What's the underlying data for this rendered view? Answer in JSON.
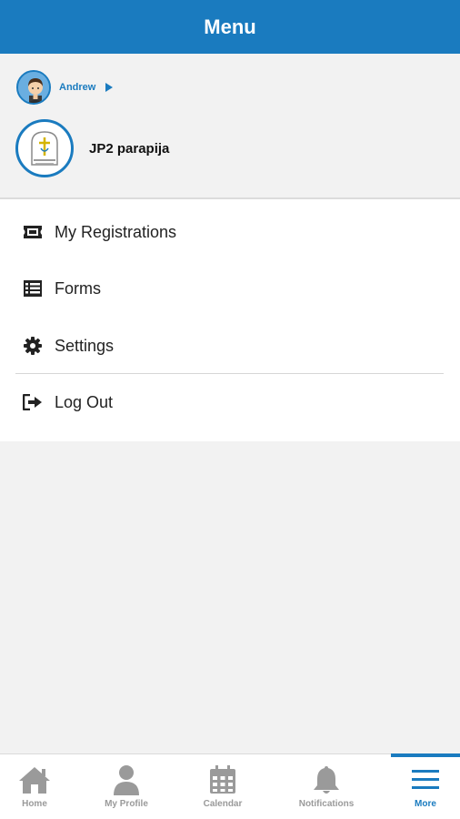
{
  "header": {
    "title": "Menu"
  },
  "user": {
    "name": "Andrew"
  },
  "organization": {
    "name": "JP2 parapija"
  },
  "menu": {
    "items": [
      {
        "label": "My Registrations",
        "icon": "ticket-icon"
      },
      {
        "label": "Forms",
        "icon": "list-icon"
      },
      {
        "label": "Settings",
        "icon": "gear-icon"
      },
      {
        "label": "Log Out",
        "icon": "logout-icon"
      }
    ]
  },
  "tabbar": {
    "tabs": [
      {
        "label": "Home",
        "icon": "home-icon"
      },
      {
        "label": "My Profile",
        "icon": "person-icon"
      },
      {
        "label": "Calendar",
        "icon": "calendar-icon"
      },
      {
        "label": "Notifications",
        "icon": "bell-icon"
      },
      {
        "label": "More",
        "icon": "hamburger-icon",
        "active": true
      }
    ]
  },
  "colors": {
    "accent": "#1a7bbf",
    "inactive": "#9a9a9a",
    "background": "#f2f2f2"
  }
}
